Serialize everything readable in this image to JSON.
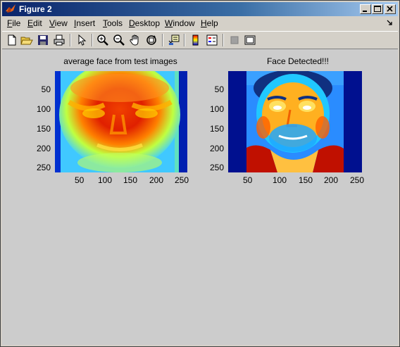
{
  "window": {
    "title": "Figure 2"
  },
  "menu": [
    {
      "label": "File",
      "key": "F",
      "rest": "ile"
    },
    {
      "label": "Edit",
      "key": "E",
      "rest": "dit"
    },
    {
      "label": "View",
      "key": "V",
      "rest": "iew"
    },
    {
      "label": "Insert",
      "key": "I",
      "rest": "nsert"
    },
    {
      "label": "Tools",
      "key": "T",
      "rest": "ools"
    },
    {
      "label": "Desktop",
      "key": "D",
      "rest": "esktop"
    },
    {
      "label": "Window",
      "key": "W",
      "rest": "indow"
    },
    {
      "label": "Help",
      "key": "H",
      "rest": "elp"
    }
  ],
  "toolbar": [
    "new-file-icon",
    "open-folder-icon",
    "save-icon",
    "print-icon",
    "select-arrow-icon",
    "zoom-in-icon",
    "zoom-out-icon",
    "pan-hand-icon",
    "rotate-3d-icon",
    "data-cursor-icon",
    "colorbar-icon",
    "legend-icon",
    "hide-plot-tools-icon",
    "show-plot-tools-icon"
  ],
  "axes": [
    {
      "title": "average face from test images",
      "xticks": [
        "50",
        "100",
        "150",
        "200",
        "250"
      ],
      "yticks": [
        "50",
        "100",
        "150",
        "200",
        "250"
      ]
    },
    {
      "title": "Face Detected!!!",
      "xticks": [
        "50",
        "100",
        "150",
        "200",
        "250"
      ],
      "yticks": [
        "50",
        "100",
        "150",
        "200",
        "250"
      ]
    }
  ],
  "colors": {
    "colormap_low": "#00008f",
    "colormap_high": "#8f0000",
    "titlebar": "#0a246a"
  }
}
